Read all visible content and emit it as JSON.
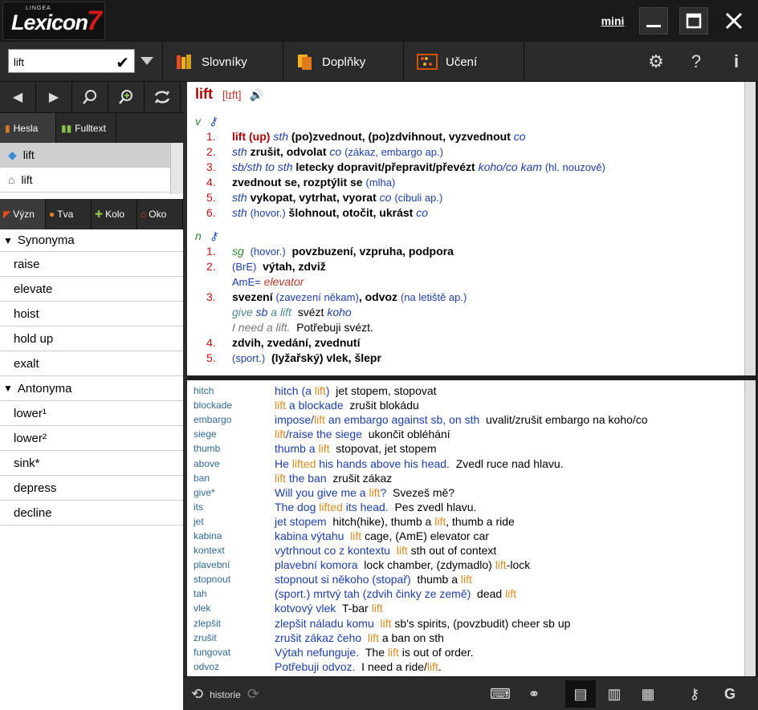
{
  "app": {
    "brand": "Lexicon",
    "brand_num": "7",
    "maker": "LINGEA",
    "mini_label": "mini"
  },
  "toolbar": {
    "search_value": "lift",
    "tabs": [
      {
        "label": "Slovníky"
      },
      {
        "label": "Doplňky"
      },
      {
        "label": "Učení"
      }
    ]
  },
  "left": {
    "tabs": [
      {
        "label": "Hesla"
      },
      {
        "label": "Fulltext"
      }
    ],
    "headwords": [
      {
        "label": "lift"
      },
      {
        "label": "lift"
      }
    ],
    "subtabs": [
      {
        "label": "Význ"
      },
      {
        "label": "Tva"
      },
      {
        "label": "Kolo"
      },
      {
        "label": "Oko"
      }
    ],
    "synonyms_header": "Synonyma",
    "synonyms": [
      "raise",
      "elevate",
      "hoist",
      "hold up",
      "exalt"
    ],
    "antonyms_header": "Antonyma",
    "antonyms": [
      "lower¹",
      "lower²",
      "sink*",
      "depress",
      "decline"
    ]
  },
  "entry": {
    "headword": "lift",
    "pron": "[lɪft]",
    "pos_v": "v",
    "pos_n": "n"
  },
  "phrases": [
    {
      "key": "hitch",
      "text": "hitch (a lift)  jet stopem, stopovat"
    },
    {
      "key": "blockade",
      "text": "lift a blockade  zrušit blokádu"
    },
    {
      "key": "embargo",
      "text": "impose/lift an embargo against sb, on sth  uvalit/zrušit embargo na koho/co"
    },
    {
      "key": "siege",
      "text": "lift/raise the siege  ukončit obléhání"
    },
    {
      "key": "thumb",
      "text": "thumb a lift  stopovat, jet stopem"
    },
    {
      "key": "above",
      "text": "He lifted his hands above his head.  Zvedl ruce nad hlavu."
    },
    {
      "key": "ban",
      "text": "lift the ban  zrušit zákaz"
    },
    {
      "key": "give*",
      "text": "Will you give me a lift?  Svezeš mě?"
    },
    {
      "key": "its",
      "text": "The dog lifted its head.  Pes zvedl hlavu."
    },
    {
      "key": "jet",
      "text": "jet stopem  hitch(hike), thumb a lift, thumb a ride"
    },
    {
      "key": "kabina",
      "text": "kabina výtahu  lift cage, (AmE) elevator car"
    },
    {
      "key": "kontext",
      "text": "vytrhnout co z kontextu  lift sth out of context"
    },
    {
      "key": "plavební",
      "text": "plavební komora  lock chamber, (zdymadlo) lift-lock"
    },
    {
      "key": "stopnout",
      "text": "stopnout si někoho (stopař)  thumb a lift"
    },
    {
      "key": "tah",
      "text": "(sport.) mrtvý tah (zdvih činky ze země)  dead lift"
    },
    {
      "key": "vlek",
      "text": "kotvový vlek  T-bar lift"
    },
    {
      "key": "zlepšit",
      "text": "zlepšit náladu komu  lift sb's spirits, (povzbudit) cheer sb up"
    },
    {
      "key": "zrušit",
      "text": "zrušit zákaz čeho  lift a ban on sth"
    },
    {
      "key": "fungovat",
      "text": "Výtah nefunguje.  The lift is out of order."
    },
    {
      "key": "odvoz",
      "text": "Potřebuji odvoz.  I need a ride/lift."
    }
  ],
  "bottom": {
    "history_label": "historie"
  }
}
